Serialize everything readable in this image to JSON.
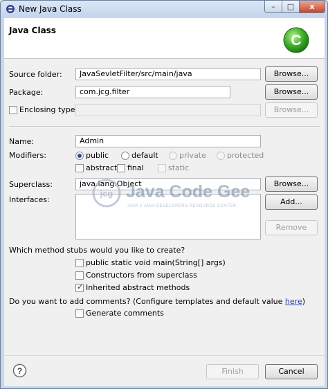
{
  "window": {
    "title": "New Java Class",
    "minimize_label": "–",
    "maximize_label": "□",
    "close_label": "x"
  },
  "header": {
    "title": "Java Class",
    "class_icon_letter": "C"
  },
  "form": {
    "source_folder": {
      "label": "Source folder:",
      "value": "JavaSevletFilter/src/main/java",
      "browse_label": "Browse..."
    },
    "package": {
      "label": "Package:",
      "value": "com.jcg.filter",
      "browse_label": "Browse..."
    },
    "enclosing_type": {
      "label": "Enclosing type:",
      "value": "",
      "browse_label": "Browse...",
      "checked": false
    },
    "name": {
      "label": "Name:",
      "value": "Admin"
    },
    "modifiers": {
      "label": "Modifiers:",
      "access": [
        {
          "label": "public",
          "checked": true,
          "enabled": true
        },
        {
          "label": "default",
          "checked": false,
          "enabled": true
        },
        {
          "label": "private",
          "checked": false,
          "enabled": false
        },
        {
          "label": "protected",
          "checked": false,
          "enabled": false
        }
      ],
      "flags": [
        {
          "label": "abstract",
          "checked": false,
          "enabled": true
        },
        {
          "label": "final",
          "checked": false,
          "enabled": true
        },
        {
          "label": "static",
          "checked": false,
          "enabled": false
        }
      ]
    },
    "superclass": {
      "label": "Superclass:",
      "value": "java.lang.Object",
      "browse_label": "Browse..."
    },
    "interfaces": {
      "label": "Interfaces:",
      "add_label": "Add...",
      "remove_label": "Remove"
    }
  },
  "stubs": {
    "question": "Which method stubs would you like to create?",
    "options": [
      {
        "label": "public static void main(String[] args)",
        "checked": false
      },
      {
        "label": "Constructors from superclass",
        "checked": false
      },
      {
        "label": "Inherited abstract methods",
        "checked": true
      }
    ]
  },
  "comments": {
    "question": "Do you want to add comments? (Configure templates and default value ",
    "link": "here",
    "question_end": ")",
    "option": {
      "label": "Generate comments",
      "checked": false
    }
  },
  "footer": {
    "help_label": "?",
    "finish_label": "Finish",
    "cancel_label": "Cancel"
  },
  "watermark": {
    "logo_text": "jcg",
    "brand": "Java Code Geeks",
    "tagline": "JAVA 2 JAVA DEVELOPERS RESOURCE CENTER"
  },
  "colors": {
    "window_frame": "#c8d8ea",
    "dialog_bg": "#f0f0f0",
    "class_icon_green": "#3fae2a",
    "link": "#1f3fae"
  }
}
